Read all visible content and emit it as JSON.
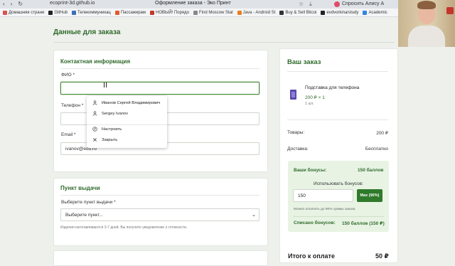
{
  "browser": {
    "url": "ecoprint-3d.github.io",
    "tab_title": "Оформление заказа - Эко Принт",
    "ask_label": "Спросить Алису А",
    "bookmarks": [
      {
        "label": "Домашняя страни",
        "color": "#d9534f"
      },
      {
        "label": "GitHub",
        "color": "#222222"
      },
      {
        "label": "Телекоммуникац",
        "color": "#3b6fb6"
      },
      {
        "label": "Пассажирам",
        "color": "#e05a2b"
      },
      {
        "label": "НОВЫЙ! Порядо",
        "color": "#c0392b"
      },
      {
        "label": "Find Moscow Stat",
        "color": "#888888"
      },
      {
        "label": "Java - Android St",
        "color": "#e67e22"
      },
      {
        "label": "Buy & Sell Bitcoi",
        "color": "#333333"
      },
      {
        "label": "evdvorkina/study",
        "color": "#222222"
      },
      {
        "label": "Academic",
        "color": "#2e86de"
      }
    ]
  },
  "page": {
    "title": "Данные для заказа"
  },
  "contact": {
    "title": "Контактная информация",
    "fio_label": "ФИО *",
    "phone_label": "Телефон *",
    "email_label": "Email *",
    "email_value": "ivanov@edu.ru"
  },
  "autocomplete": {
    "items": [
      {
        "label": "Иванов Сергей Владимирович",
        "icon": "person-icon"
      },
      {
        "label": "Sergey Ivanov",
        "icon": "person-icon"
      },
      {
        "label": "Настроить",
        "icon": "browser-logo-icon"
      },
      {
        "label": "Закрыть",
        "icon": "close-icon"
      }
    ]
  },
  "pickup": {
    "title": "Пункт выдачи",
    "label": "Выберите пункт выдачи *",
    "selected": "Выберите пункт...",
    "hint": "Изделия изготавливаются 3-7 дней. Вы получите уведомление о готовности."
  },
  "order": {
    "title": "Ваш заказ",
    "product": {
      "name": "Подставка для телефона",
      "price": "200 ₽ × 1",
      "qty": "1 шт."
    },
    "goods_label": "Товары:",
    "goods_value": "200 ₽",
    "delivery_label": "Доставка:",
    "delivery_value": "Бесплатно",
    "bonus": {
      "label": "Ваши бонусы:",
      "value": "150 баллов",
      "use_label": "Использовать бонусов:",
      "input_value": "150",
      "max_button": "Max (90%)",
      "note": "Можно оплатить до 90% суммы заказа",
      "spent_label": "Списано бонусов:",
      "spent_value": "150 баллов (150 ₽)"
    },
    "total_label": "Итого к оплате",
    "total_value": "50 ₽"
  },
  "colors": {
    "accent": "#2f6b2b",
    "button": "#2f7a2b",
    "bonus_bg": "#e8f3e3"
  }
}
